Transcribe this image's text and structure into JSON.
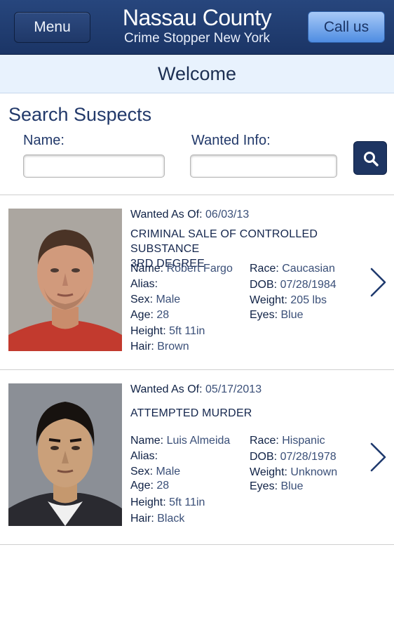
{
  "header": {
    "menu_label": "Menu",
    "title": "Nassau County",
    "subtitle": "Crime Stopper New York",
    "call_label": "Call us"
  },
  "welcome": "Welcome",
  "search": {
    "title": "Search Suspects",
    "name_label": "Name:",
    "name_value": "",
    "wanted_label": "Wanted Info:",
    "wanted_value": "",
    "button_icon": "search-icon"
  },
  "labels": {
    "wanted_as_of": "Wanted As Of:",
    "name": "Name:",
    "alias": "Alias:",
    "sex": "Sex:",
    "age": "Age:",
    "height": "Height:",
    "hair": "Hair:",
    "race": "Race:",
    "dob": "DOB:",
    "weight": "Weight:",
    "eyes": "Eyes:"
  },
  "suspects": [
    {
      "wanted_date": "06/03/13",
      "crime_line1": "CRIMINAL SALE OF CONTROLLED SUBSTANCE",
      "crime_line2": "3RD DEGREE",
      "name": "Robert Fargo",
      "alias": "",
      "sex": "Male",
      "age": "28",
      "height": "5ft 11in",
      "hair": "Brown",
      "race": "Caucasian",
      "dob": "07/28/1984",
      "weight": "205 lbs",
      "eyes": "Blue"
    },
    {
      "wanted_date": "05/17/2013",
      "crime_line1": "ATTEMPTED MURDER",
      "crime_line2": "",
      "name": "Luis Almeida",
      "alias": "",
      "sex": "Male",
      "age": "28",
      "height": "5ft 11in",
      "hair": "Black",
      "race": "Hispanic",
      "dob": "07/28/1978",
      "weight": "Unknown",
      "eyes": "Blue"
    }
  ],
  "colors": {
    "header_bg": "#1f3a6e",
    "accent_button": "#6aa3ec",
    "welcome_bg": "#e8f2fd",
    "text_primary": "#1c2f52"
  }
}
